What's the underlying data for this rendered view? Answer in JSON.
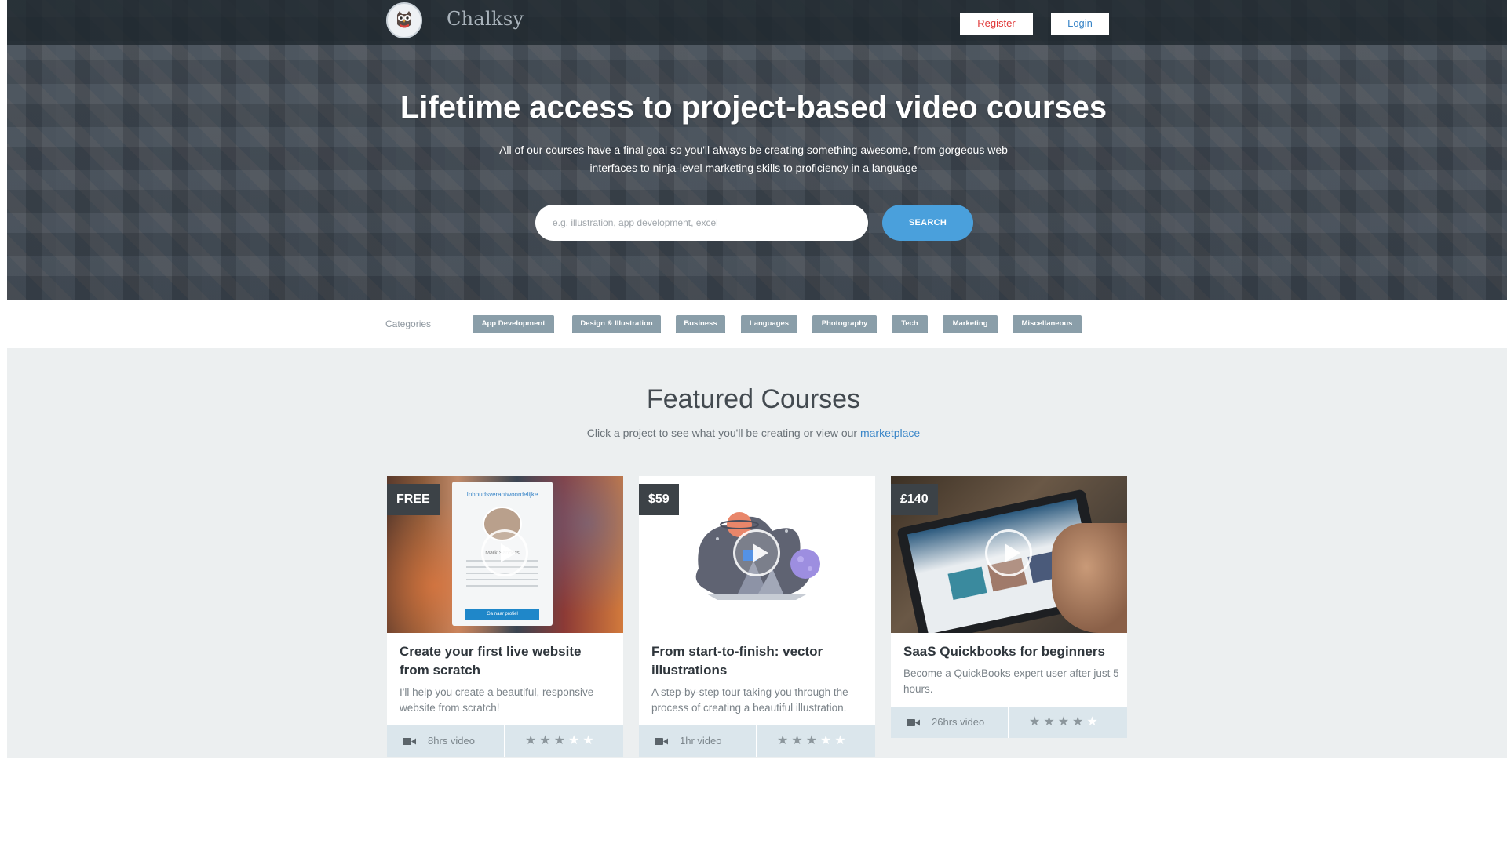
{
  "header": {
    "brand": "Chalksy",
    "register_label": "Register",
    "login_label": "Login"
  },
  "hero": {
    "title": "Lifetime access to project-based video courses",
    "subtitle": "All of our courses have a final goal so you'll always be creating something awesome, from gorgeous web interfaces to ninja-level marketing skills to proficiency in a language",
    "search_placeholder": "e.g. illustration, app development, excel",
    "search_button": "SEARCH"
  },
  "categories": {
    "label": "Categories",
    "items": [
      "App Development",
      "Design & Illustration",
      "Business",
      "Languages",
      "Photography",
      "Tech",
      "Marketing",
      "Miscellaneous"
    ]
  },
  "featured": {
    "title": "Featured Courses",
    "subtitle_prefix": "Click a project to see what you'll be creating or view our ",
    "subtitle_link": "marketplace"
  },
  "courses": [
    {
      "price": "FREE",
      "title": "Create your first live website from scratch",
      "description": "I'll help you create a beautiful, responsive website from scratch!",
      "video": "8hrs video",
      "rating": 3,
      "rating_max": 5,
      "thumb_text_top": "Inhoudsverantwoordelijke",
      "thumb_text_name": "Mark Sanders",
      "thumb_button": "Ga naar profiel"
    },
    {
      "price": "$59",
      "title": "From start-to-finish: vector illustrations",
      "description": "A step-by-step tour taking you through the process of creating a beautiful illustration.",
      "video": "1hr video",
      "rating": 3,
      "rating_max": 5
    },
    {
      "price": "£140",
      "title": "SaaS Quickbooks for beginners",
      "description": "Become a QuickBooks expert user after just 5 hours.",
      "video": "26hrs video",
      "rating": 4,
      "rating_max": 5
    }
  ],
  "colors": {
    "accent_blue": "#4aa0dc",
    "register_red": "#e03a3a",
    "category_bg": "#8a9ea9",
    "section_bg": "#eceff0",
    "card_footer": "#dbe6ec"
  },
  "icons": {
    "logo": "owl-logo-icon",
    "video": "video-camera-icon",
    "play": "play-icon",
    "star": "star-icon"
  }
}
